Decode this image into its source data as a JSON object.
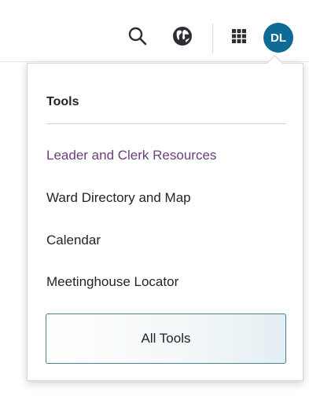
{
  "header": {
    "search_icon": "search-icon",
    "globe_icon": "globe-icon",
    "apps_icon": "apps-grid-icon",
    "avatar": {
      "initials": "DL",
      "color": "#0e6b94"
    }
  },
  "menu": {
    "section_title": "Tools",
    "items": [
      {
        "label": "Leader and Clerk Resources",
        "active": true,
        "color": "#6b3f7d"
      },
      {
        "label": "Ward Directory and Map",
        "active": false
      },
      {
        "label": "Calendar",
        "active": false
      },
      {
        "label": "Meetinghouse Locator",
        "active": false
      }
    ],
    "all_tools_label": "All Tools"
  }
}
